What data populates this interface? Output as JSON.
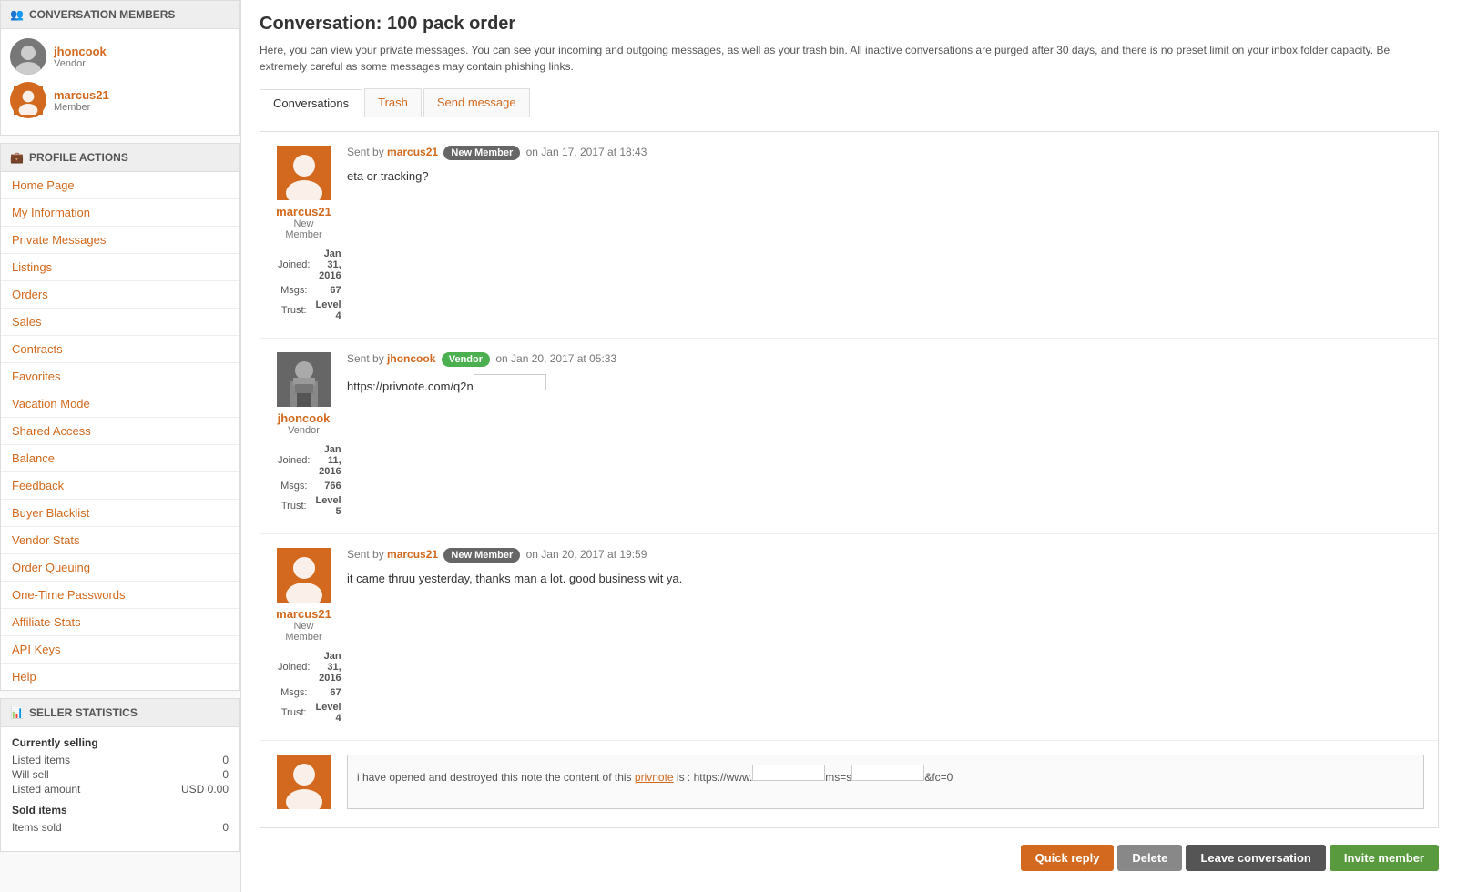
{
  "sidebar": {
    "conversation_members_header": "CONVERSATION MEMBERS",
    "members": [
      {
        "username": "jhoncook",
        "role": "Vendor",
        "has_photo": true
      },
      {
        "username": "marcus21",
        "role": "Member",
        "has_photo": false
      }
    ],
    "profile_actions_header": "PROFILE ACTIONS",
    "profile_actions": [
      {
        "label": "Home Page"
      },
      {
        "label": "My Information"
      },
      {
        "label": "Private Messages"
      },
      {
        "label": "Listings"
      },
      {
        "label": "Orders"
      },
      {
        "label": "Sales"
      },
      {
        "label": "Contracts"
      },
      {
        "label": "Favorites"
      },
      {
        "label": "Vacation Mode"
      },
      {
        "label": "Shared Access"
      },
      {
        "label": "Balance"
      },
      {
        "label": "Feedback"
      },
      {
        "label": "Buyer Blacklist"
      },
      {
        "label": "Vendor Stats"
      },
      {
        "label": "Order Queuing"
      },
      {
        "label": "One-Time Passwords"
      },
      {
        "label": "Affiliate Stats"
      },
      {
        "label": "API Keys"
      },
      {
        "label": "Help"
      }
    ],
    "seller_stats_header": "SELLER STATISTICS",
    "currently_selling_label": "Currently selling",
    "listed_items_label": "Listed items",
    "listed_items_value": "0",
    "will_sell_label": "Will sell",
    "will_sell_value": "0",
    "listed_amount_label": "Listed amount",
    "listed_amount_value": "USD 0.00",
    "sold_items_label": "Sold items",
    "items_sold_label": "Items sold",
    "items_sold_value": "0"
  },
  "main": {
    "page_title": "Conversation: 100 pack order",
    "page_description": "Here, you can view your private messages. You can see your incoming and outgoing messages, as well as your trash bin. All inactive conversations are purged after 30 days, and there is no preset limit on your inbox folder capacity. Be extremely careful as some messages may contain phishing links.",
    "tabs": [
      {
        "label": "Conversations",
        "active": true
      },
      {
        "label": "Trash",
        "orange": true
      },
      {
        "label": "Send message",
        "orange": true
      }
    ],
    "messages": [
      {
        "avatar_type": "orange",
        "username": "marcus21",
        "role": "New Member",
        "joined": "Jan 31, 2016",
        "msgs": "67",
        "trust": "Level 4",
        "sent_by": "marcus21",
        "badge": "New Member",
        "badge_type": "new_member",
        "sent_on": "Jan 17, 2017 at 18:43",
        "text": "eta or tracking?"
      },
      {
        "avatar_type": "photo",
        "username": "jhoncook",
        "role": "Vendor",
        "joined": "Jan 11, 2016",
        "msgs": "766",
        "trust": "Level 5",
        "sent_by": "jhoncook",
        "badge": "Vendor",
        "badge_type": "vendor",
        "sent_on": "Jan 20, 2017 at 05:33",
        "text": "https://privnote.com/q2n",
        "has_masked_link": true
      },
      {
        "avatar_type": "orange",
        "username": "marcus21",
        "role": "New Member",
        "joined": "Jan 31, 2016",
        "msgs": "67",
        "trust": "Level 4",
        "sent_by": "marcus21",
        "badge": "New Member",
        "badge_type": "new_member",
        "sent_on": "Jan 20, 2017 at 19:59",
        "text": "it came thruu yesterday, thanks man a lot. good business wit ya."
      },
      {
        "avatar_type": "orange",
        "username": "",
        "role": "",
        "joined": "",
        "msgs": "",
        "trust": "",
        "sent_by": "",
        "badge": "",
        "badge_type": "",
        "sent_on": "",
        "text": "i have opened and destroyed this note the content of this privnote is : https://www.",
        "has_masked_link2": true,
        "last_item": true
      }
    ],
    "actions": {
      "quick_reply": "Quick reply",
      "delete": "Delete",
      "leave_conversation": "Leave conversation",
      "invite_member": "Invite member"
    }
  }
}
